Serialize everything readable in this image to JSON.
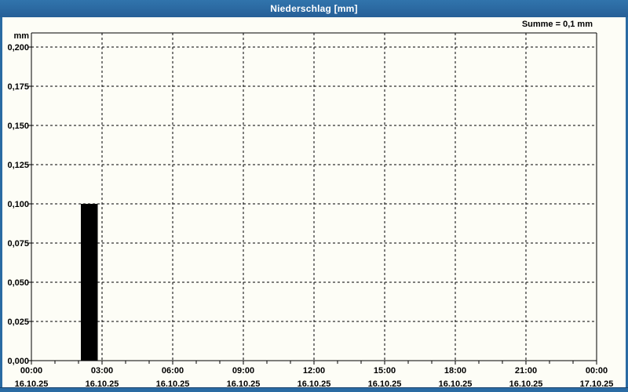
{
  "window": {
    "title": "Niederschlag [mm]",
    "summary": "Summe = 0,1 mm"
  },
  "colors": {
    "titlebar_blue": "#2a6ba3",
    "frame_blue": "#2a6ba3",
    "frame_dark_edge": "#17406a",
    "background": "#fdfdf6",
    "bar": "#000000",
    "grid_and_text": "#000000"
  },
  "chart_data": {
    "type": "bar",
    "title": "Niederschlag [mm]",
    "ylabel": "mm",
    "sum_annotation": "Summe = 0,1 mm",
    "ylim": [
      0,
      0.2
    ],
    "y_tick_step": 0.025,
    "y_tick_labels": [
      "0,000",
      "0,025",
      "0,050",
      "0,075",
      "0,100",
      "0,125",
      "0,150",
      "0,175",
      "0,200"
    ],
    "x_axis_hours": 24,
    "minor_tick_every_hours": 1,
    "grid": true,
    "x_ticks": [
      {
        "hour": 0,
        "time": "00:00",
        "date": "16.10.25"
      },
      {
        "hour": 3,
        "time": "03:00",
        "date": "16.10.25"
      },
      {
        "hour": 6,
        "time": "06:00",
        "date": "16.10.25"
      },
      {
        "hour": 9,
        "time": "09:00",
        "date": "16.10.25"
      },
      {
        "hour": 12,
        "time": "12:00",
        "date": "16.10.25"
      },
      {
        "hour": 15,
        "time": "15:00",
        "date": "16.10.25"
      },
      {
        "hour": 18,
        "time": "18:00",
        "date": "16.10.25"
      },
      {
        "hour": 21,
        "time": "21:00",
        "date": "16.10.25"
      },
      {
        "hour": 24,
        "time": "00:00",
        "date": "17.10.25"
      }
    ],
    "bars": [
      {
        "start_hour": 2.1,
        "end_hour": 2.82,
        "value": 0.1
      }
    ]
  }
}
